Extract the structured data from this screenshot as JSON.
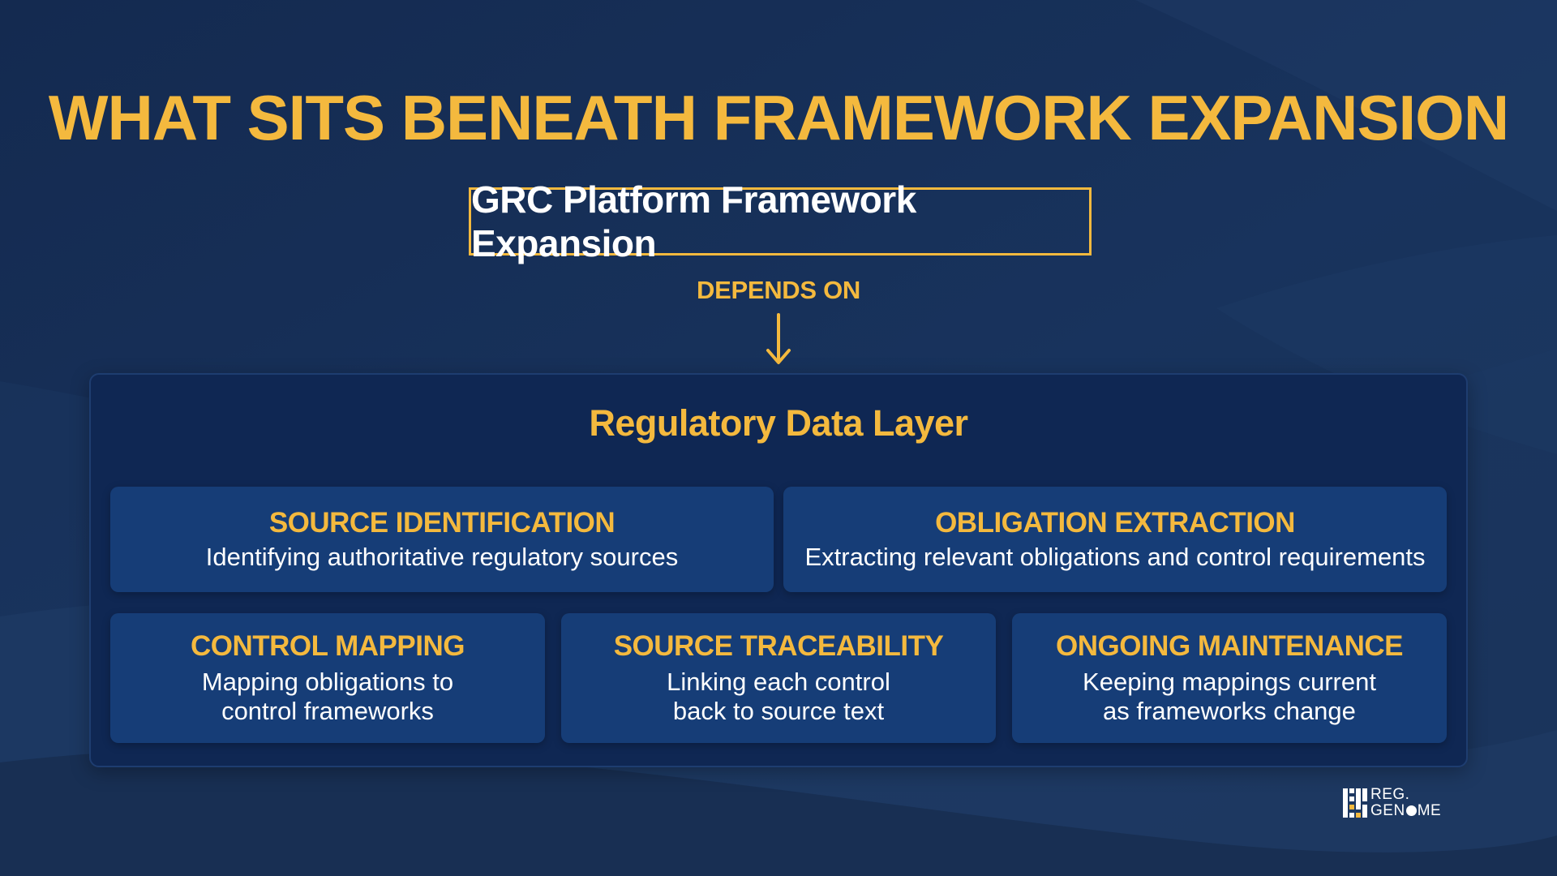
{
  "title": "WHAT SITS BENEATH FRAMEWORK EXPANSION",
  "top_box": {
    "label": "GRC Platform Framework Expansion"
  },
  "connector": {
    "label": "DEPENDS ON",
    "arrow_icon": "arrow-down-icon"
  },
  "layer": {
    "title": "Regulatory Data Layer",
    "cards": [
      {
        "title": "SOURCE IDENTIFICATION",
        "desc": "Identifying authoritative regulatory sources"
      },
      {
        "title": "OBLIGATION EXTRACTION",
        "desc": "Extracting relevant obligations and control requirements"
      },
      {
        "title": "CONTROL MAPPING",
        "desc": "Mapping obligations to\ncontrol frameworks"
      },
      {
        "title": "SOURCE TRACEABILITY",
        "desc": "Linking each control\nback to source text"
      },
      {
        "title": "ONGOING MAINTENANCE",
        "desc": "Keeping mappings current\nas frameworks change"
      }
    ]
  },
  "logo": {
    "line1": "REG.",
    "line2_a": "GEN",
    "line2_b": "ME"
  },
  "colors": {
    "accent": "#f4b93e",
    "background": "#15284a",
    "panel": "#0f2753",
    "card": "#163d77",
    "text": "#ffffff"
  }
}
